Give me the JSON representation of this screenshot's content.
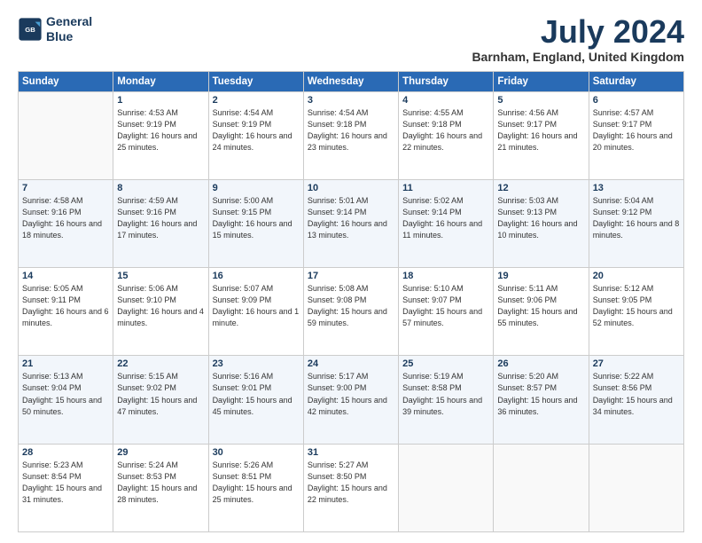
{
  "header": {
    "logo_line1": "General",
    "logo_line2": "Blue",
    "month_title": "July 2024",
    "location": "Barnham, England, United Kingdom"
  },
  "weekdays": [
    "Sunday",
    "Monday",
    "Tuesday",
    "Wednesday",
    "Thursday",
    "Friday",
    "Saturday"
  ],
  "weeks": [
    [
      {
        "day": "",
        "sunrise": "",
        "sunset": "",
        "daylight": ""
      },
      {
        "day": "1",
        "sunrise": "Sunrise: 4:53 AM",
        "sunset": "Sunset: 9:19 PM",
        "daylight": "Daylight: 16 hours and 25 minutes."
      },
      {
        "day": "2",
        "sunrise": "Sunrise: 4:54 AM",
        "sunset": "Sunset: 9:19 PM",
        "daylight": "Daylight: 16 hours and 24 minutes."
      },
      {
        "day": "3",
        "sunrise": "Sunrise: 4:54 AM",
        "sunset": "Sunset: 9:18 PM",
        "daylight": "Daylight: 16 hours and 23 minutes."
      },
      {
        "day": "4",
        "sunrise": "Sunrise: 4:55 AM",
        "sunset": "Sunset: 9:18 PM",
        "daylight": "Daylight: 16 hours and 22 minutes."
      },
      {
        "day": "5",
        "sunrise": "Sunrise: 4:56 AM",
        "sunset": "Sunset: 9:17 PM",
        "daylight": "Daylight: 16 hours and 21 minutes."
      },
      {
        "day": "6",
        "sunrise": "Sunrise: 4:57 AM",
        "sunset": "Sunset: 9:17 PM",
        "daylight": "Daylight: 16 hours and 20 minutes."
      }
    ],
    [
      {
        "day": "7",
        "sunrise": "Sunrise: 4:58 AM",
        "sunset": "Sunset: 9:16 PM",
        "daylight": "Daylight: 16 hours and 18 minutes."
      },
      {
        "day": "8",
        "sunrise": "Sunrise: 4:59 AM",
        "sunset": "Sunset: 9:16 PM",
        "daylight": "Daylight: 16 hours and 17 minutes."
      },
      {
        "day": "9",
        "sunrise": "Sunrise: 5:00 AM",
        "sunset": "Sunset: 9:15 PM",
        "daylight": "Daylight: 16 hours and 15 minutes."
      },
      {
        "day": "10",
        "sunrise": "Sunrise: 5:01 AM",
        "sunset": "Sunset: 9:14 PM",
        "daylight": "Daylight: 16 hours and 13 minutes."
      },
      {
        "day": "11",
        "sunrise": "Sunrise: 5:02 AM",
        "sunset": "Sunset: 9:14 PM",
        "daylight": "Daylight: 16 hours and 11 minutes."
      },
      {
        "day": "12",
        "sunrise": "Sunrise: 5:03 AM",
        "sunset": "Sunset: 9:13 PM",
        "daylight": "Daylight: 16 hours and 10 minutes."
      },
      {
        "day": "13",
        "sunrise": "Sunrise: 5:04 AM",
        "sunset": "Sunset: 9:12 PM",
        "daylight": "Daylight: 16 hours and 8 minutes."
      }
    ],
    [
      {
        "day": "14",
        "sunrise": "Sunrise: 5:05 AM",
        "sunset": "Sunset: 9:11 PM",
        "daylight": "Daylight: 16 hours and 6 minutes."
      },
      {
        "day": "15",
        "sunrise": "Sunrise: 5:06 AM",
        "sunset": "Sunset: 9:10 PM",
        "daylight": "Daylight: 16 hours and 4 minutes."
      },
      {
        "day": "16",
        "sunrise": "Sunrise: 5:07 AM",
        "sunset": "Sunset: 9:09 PM",
        "daylight": "Daylight: 16 hours and 1 minute."
      },
      {
        "day": "17",
        "sunrise": "Sunrise: 5:08 AM",
        "sunset": "Sunset: 9:08 PM",
        "daylight": "Daylight: 15 hours and 59 minutes."
      },
      {
        "day": "18",
        "sunrise": "Sunrise: 5:10 AM",
        "sunset": "Sunset: 9:07 PM",
        "daylight": "Daylight: 15 hours and 57 minutes."
      },
      {
        "day": "19",
        "sunrise": "Sunrise: 5:11 AM",
        "sunset": "Sunset: 9:06 PM",
        "daylight": "Daylight: 15 hours and 55 minutes."
      },
      {
        "day": "20",
        "sunrise": "Sunrise: 5:12 AM",
        "sunset": "Sunset: 9:05 PM",
        "daylight": "Daylight: 15 hours and 52 minutes."
      }
    ],
    [
      {
        "day": "21",
        "sunrise": "Sunrise: 5:13 AM",
        "sunset": "Sunset: 9:04 PM",
        "daylight": "Daylight: 15 hours and 50 minutes."
      },
      {
        "day": "22",
        "sunrise": "Sunrise: 5:15 AM",
        "sunset": "Sunset: 9:02 PM",
        "daylight": "Daylight: 15 hours and 47 minutes."
      },
      {
        "day": "23",
        "sunrise": "Sunrise: 5:16 AM",
        "sunset": "Sunset: 9:01 PM",
        "daylight": "Daylight: 15 hours and 45 minutes."
      },
      {
        "day": "24",
        "sunrise": "Sunrise: 5:17 AM",
        "sunset": "Sunset: 9:00 PM",
        "daylight": "Daylight: 15 hours and 42 minutes."
      },
      {
        "day": "25",
        "sunrise": "Sunrise: 5:19 AM",
        "sunset": "Sunset: 8:58 PM",
        "daylight": "Daylight: 15 hours and 39 minutes."
      },
      {
        "day": "26",
        "sunrise": "Sunrise: 5:20 AM",
        "sunset": "Sunset: 8:57 PM",
        "daylight": "Daylight: 15 hours and 36 minutes."
      },
      {
        "day": "27",
        "sunrise": "Sunrise: 5:22 AM",
        "sunset": "Sunset: 8:56 PM",
        "daylight": "Daylight: 15 hours and 34 minutes."
      }
    ],
    [
      {
        "day": "28",
        "sunrise": "Sunrise: 5:23 AM",
        "sunset": "Sunset: 8:54 PM",
        "daylight": "Daylight: 15 hours and 31 minutes."
      },
      {
        "day": "29",
        "sunrise": "Sunrise: 5:24 AM",
        "sunset": "Sunset: 8:53 PM",
        "daylight": "Daylight: 15 hours and 28 minutes."
      },
      {
        "day": "30",
        "sunrise": "Sunrise: 5:26 AM",
        "sunset": "Sunset: 8:51 PM",
        "daylight": "Daylight: 15 hours and 25 minutes."
      },
      {
        "day": "31",
        "sunrise": "Sunrise: 5:27 AM",
        "sunset": "Sunset: 8:50 PM",
        "daylight": "Daylight: 15 hours and 22 minutes."
      },
      {
        "day": "",
        "sunrise": "",
        "sunset": "",
        "daylight": ""
      },
      {
        "day": "",
        "sunrise": "",
        "sunset": "",
        "daylight": ""
      },
      {
        "day": "",
        "sunrise": "",
        "sunset": "",
        "daylight": ""
      }
    ]
  ]
}
